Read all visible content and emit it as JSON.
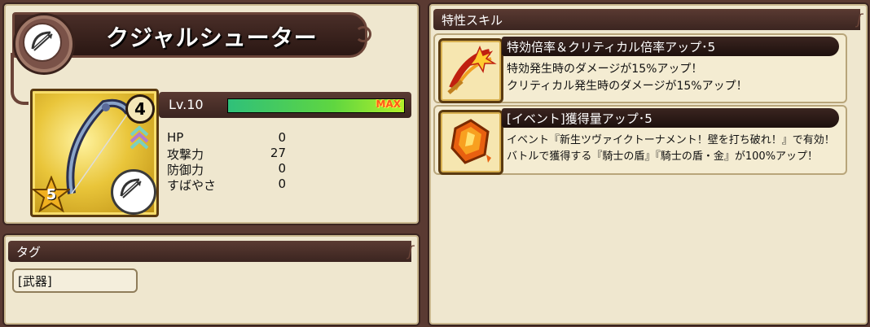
{
  "character": {
    "name": "クジャルシューター",
    "level_badge": "4",
    "star_rank": "5",
    "level_text": "Lv.10",
    "exp_fraction": 1.0,
    "exp_label": "MAX"
  },
  "stats": [
    {
      "label": "HP",
      "value": "0"
    },
    {
      "label": "攻撃力",
      "value": "27"
    },
    {
      "label": "防御力",
      "value": "0"
    },
    {
      "label": "すばやさ",
      "value": "0"
    }
  ],
  "tags": {
    "header": "タグ",
    "items": [
      "[武器]"
    ]
  },
  "skills": {
    "header": "特性スキル",
    "items": [
      {
        "title": "特効倍率＆クリティカル倍率アップ･5",
        "lines": [
          "特効発生時のダメージが15%アップ！",
          "クリティカル発生時のダメージが15%アップ！"
        ],
        "icon": "critical-slash-icon"
      },
      {
        "title": "[イベント]獲得量アップ･5",
        "lines": [
          "イベント『新生ツヴァイクトーナメント！壁を打ち破れ！』で有効！",
          "バトルで獲得する『騎士の盾』『騎士の盾・金』が100%アップ！"
        ],
        "icon": "amber-gem-icon"
      }
    ]
  },
  "colors": {
    "background": "#5a3a32",
    "panel": "#efe7cf",
    "exp_bar": "#5fd640",
    "max_label": "#ff5a1a"
  },
  "icons": {
    "class": "bow-icon",
    "weapon": "bow-weapon-icon",
    "chevron": "rank-up-chevron-icon",
    "star": "star-icon"
  }
}
